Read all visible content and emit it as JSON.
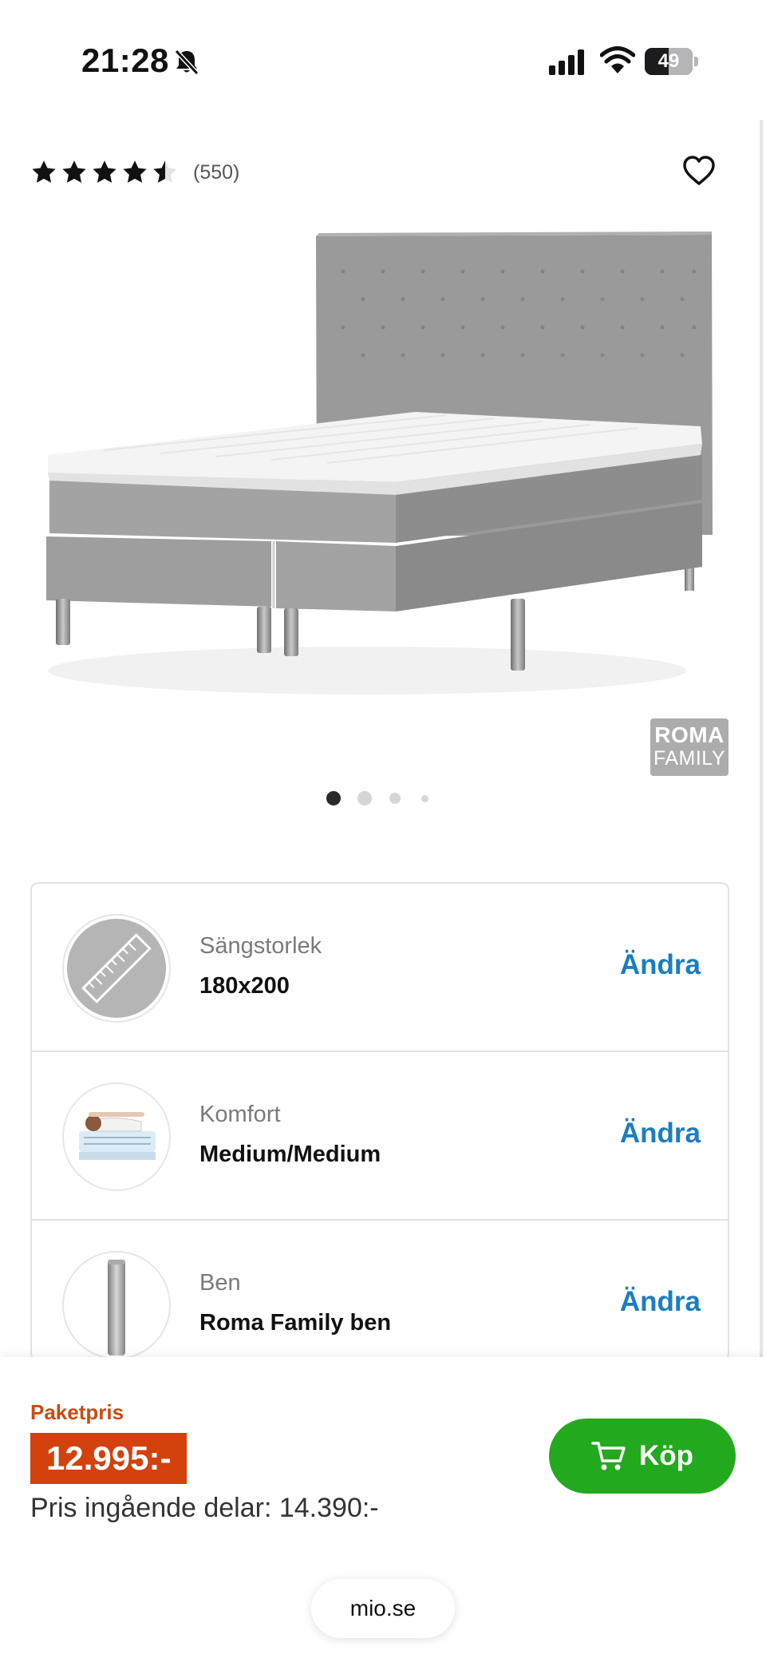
{
  "status_bar": {
    "time": "21:28",
    "battery": "49"
  },
  "product": {
    "rating": 4.5,
    "rating_max": 5,
    "review_count": "(550)",
    "brand_logo_line1": "ROMA",
    "brand_logo_line2": "FAMILY",
    "image_count": 4,
    "active_image": 1
  },
  "options": [
    {
      "label": "Sängstorlek",
      "value": "180x200",
      "action": "Ändra",
      "icon": "ruler-icon"
    },
    {
      "label": "Komfort",
      "value": "Medium/Medium",
      "action": "Ändra",
      "icon": "comfort-mattress-icon"
    },
    {
      "label": "Ben",
      "value": "Roma Family ben",
      "action": "Ändra",
      "icon": "bed-leg-icon"
    }
  ],
  "price_bar": {
    "package_label": "Paketpris",
    "price": "12.995:-",
    "parts_price": "Pris ingående delar: 14.390:-",
    "buy_label": "Köp"
  },
  "browser": {
    "url": "mio.se"
  },
  "colors": {
    "accent_link": "#1a7ec1",
    "price_orange": "#d3410c",
    "buy_green": "#23a91e",
    "fabric_gray": "#9a9a9a"
  }
}
